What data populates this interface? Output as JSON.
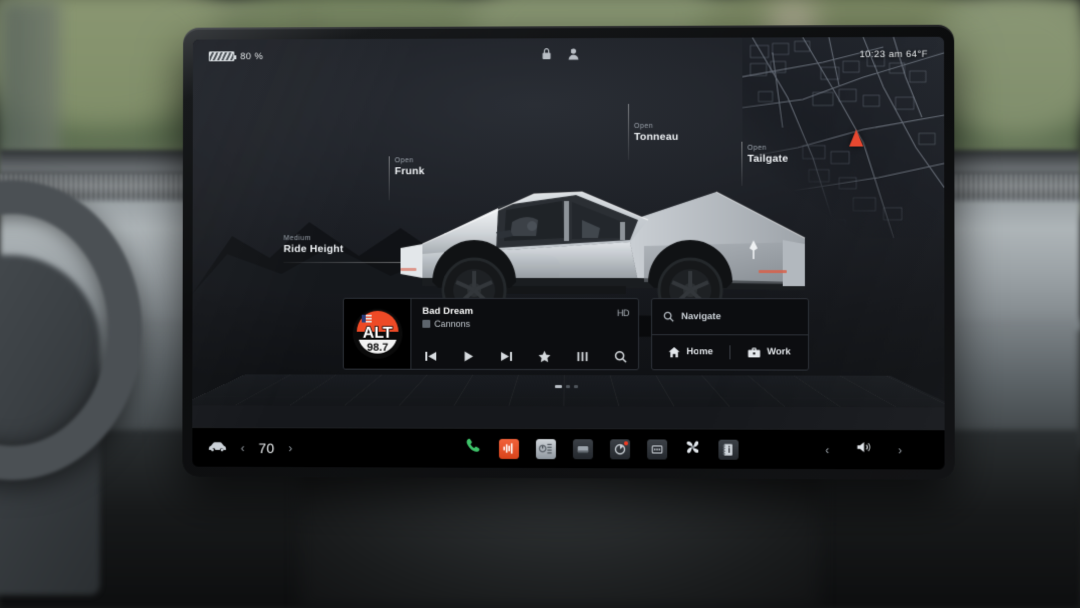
{
  "status_bar": {
    "battery_percent": "80 %",
    "battery_icon": "battery-icon",
    "lock_icon": "lock-icon",
    "profile_icon": "profile-icon",
    "time": "10:23 am",
    "temperature": "64°F",
    "time_temp": "10:23 am  64°F"
  },
  "vehicle_controls": [
    {
      "sub": "Open",
      "main": "Frunk",
      "name": "frunk-control"
    },
    {
      "sub": "Open",
      "main": "Tonneau",
      "name": "tonneau-control"
    },
    {
      "sub": "Open",
      "main": "Tailgate",
      "name": "tailgate-control"
    },
    {
      "sub": "Medium",
      "main": "Ride Height",
      "name": "ride-height-control"
    }
  ],
  "media": {
    "station_logo": {
      "call_letters": "ALT",
      "frequency": "98.7"
    },
    "track_title": "Bad Dream",
    "artist": "Cannons",
    "hd_badge": "HD",
    "controls": [
      {
        "name": "previous-track-button",
        "icon": "skip-previous-icon"
      },
      {
        "name": "play-button",
        "icon": "play-icon"
      },
      {
        "name": "next-track-button",
        "icon": "skip-next-icon"
      },
      {
        "name": "favorite-button",
        "icon": "star-icon"
      },
      {
        "name": "equalizer-button",
        "icon": "equalizer-icon"
      },
      {
        "name": "search-media-button",
        "icon": "search-icon"
      }
    ]
  },
  "navigation": {
    "search_placeholder": "Navigate",
    "search_icon": "search-icon",
    "shortcuts": [
      {
        "label": "Home",
        "icon": "home-icon",
        "name": "nav-shortcut-home"
      },
      {
        "label": "Work",
        "icon": "briefcase-icon",
        "name": "nav-shortcut-work"
      }
    ]
  },
  "map": {
    "position_marker": "navigation-arrow-icon",
    "marker_color": "#e8472f"
  },
  "taskbar": {
    "car_icon": "car-icon",
    "temperature_value": "70",
    "temp_decrease_icon": "chevron-left-icon",
    "temp_increase_icon": "chevron-right-icon",
    "phone_icon": "phone-icon",
    "phone_color": "#3ec46a",
    "apps": [
      {
        "name": "media-app-icon",
        "icon": "media-waveform-icon",
        "style": "media",
        "badge": false
      },
      {
        "name": "controls-app-icon",
        "icon": "gauge-icon",
        "style": "grey",
        "badge": false
      },
      {
        "name": "display-app-icon",
        "icon": "screen-icon",
        "style": "dark",
        "badge": false
      },
      {
        "name": "dashcam-app-icon",
        "icon": "camera-icon",
        "style": "dark",
        "badge": true
      },
      {
        "name": "more-apps-icon",
        "icon": "dots-icon",
        "style": "dark",
        "badge": false
      },
      {
        "name": "climate-fan-icon",
        "icon": "fan-icon",
        "style": "plain",
        "badge": false
      },
      {
        "name": "info-app-icon",
        "icon": "info-list-icon",
        "style": "dark",
        "badge": false
      }
    ],
    "volume_down_icon": "chevron-left-icon",
    "volume_icon": "speaker-icon",
    "volume_up_icon": "chevron-right-icon"
  },
  "page_indicator": {
    "total": 3,
    "active": 1
  },
  "colors": {
    "accent_orange": "#e0491f",
    "screen_bg": "#16181c",
    "card_bg": "#0c0d10",
    "card_border": "#2d3138",
    "text_primary": "#f0f3f6",
    "text_secondary": "#9aa2ab"
  }
}
